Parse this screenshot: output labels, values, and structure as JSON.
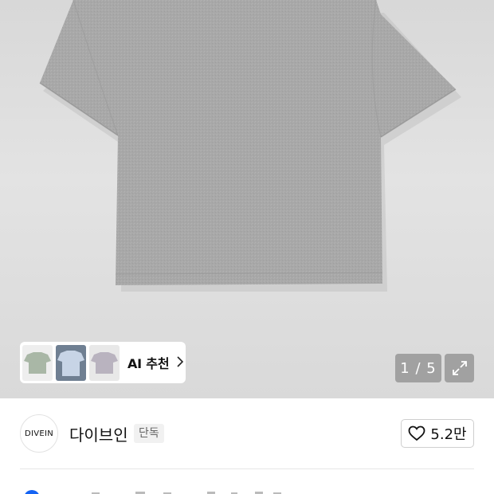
{
  "gallery": {
    "pager_current": "1",
    "pager_separator": "/",
    "pager_total": "5",
    "pager_text": "1 / 5"
  },
  "ai_recommend": {
    "label": "AI 추천",
    "chevron": "›",
    "thumbnails": [
      {
        "color": "#a9b7a6",
        "name": "sage"
      },
      {
        "color": "#c7d4e6",
        "name": "light-blue"
      },
      {
        "color": "#b9b3bf",
        "name": "lavender-gray"
      }
    ]
  },
  "brand": {
    "logo_text": "DIVEIN",
    "name": "다이브인",
    "tag": "단독",
    "likes": "5.2만"
  },
  "icons": {
    "expand": "expand-icon",
    "heart": "heart-icon",
    "chevron": "chevron-right-icon"
  },
  "colors": {
    "shirt": "#a6a6a6",
    "accent_blue": "#1463f3"
  }
}
